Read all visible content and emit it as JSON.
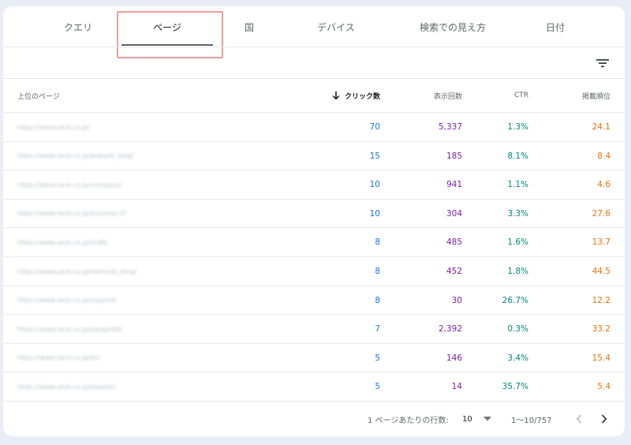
{
  "tabs": [
    {
      "label": "クエリ"
    },
    {
      "label": "ページ"
    },
    {
      "label": "国"
    },
    {
      "label": "デバイス"
    },
    {
      "label": "検索での見え方"
    },
    {
      "label": "日付"
    }
  ],
  "table": {
    "headers": {
      "page": "上位のページ",
      "clicks": "クリック数",
      "impressions": "表示回数",
      "ctr": "CTR",
      "position": "掲載順位"
    },
    "rows": [
      {
        "url": "https://www.seck.co.jp/",
        "clicks": "70",
        "impressions": "5,337",
        "ctr": "1.3%",
        "position": "24.1"
      },
      {
        "url": "https://www.seck.co.jp/website_blog/",
        "clicks": "15",
        "impressions": "185",
        "ctr": "8.1%",
        "position": "8.4"
      },
      {
        "url": "https://www.seck.co.jp/company/",
        "clicks": "10",
        "impressions": "941",
        "ctr": "1.1%",
        "position": "4.6"
      },
      {
        "url": "https://www.seck.co.jp/business-2/",
        "clicks": "10",
        "impressions": "304",
        "ctr": "3.3%",
        "position": "27.6"
      },
      {
        "url": "https://www.seck.co.jp/draft/",
        "clicks": "8",
        "impressions": "485",
        "ctr": "1.6%",
        "position": "13.7"
      },
      {
        "url": "https://www.seck.co.jp/methods_blog/",
        "clicks": "8",
        "impressions": "452",
        "ctr": "1.8%",
        "position": "44.5"
      },
      {
        "url": "https://www.seck.co.jp/support/",
        "clicks": "8",
        "impressions": "30",
        "ctr": "26.7%",
        "position": "12.2"
      },
      {
        "url": "https://www.seck.co.jp/pamphlet/",
        "clicks": "7",
        "impressions": "2,392",
        "ctr": "0.3%",
        "position": "33.2"
      },
      {
        "url": "https://www.seck.co.jp/dx/",
        "clicks": "5",
        "impressions": "146",
        "ctr": "3.4%",
        "position": "15.4"
      },
      {
        "url": "https://www.seck.co.jp/experts/",
        "clicks": "5",
        "impressions": "14",
        "ctr": "35.7%",
        "position": "5.4"
      }
    ]
  },
  "footer": {
    "rows_per_page_label": "1 ページあたりの行数:",
    "rows_per_page_value": "10",
    "range": "1〜10/757"
  },
  "colors": {
    "clicks": "#1a73e8",
    "impressions": "#7b1fa2",
    "ctr": "#00897b",
    "position": "#e8710a",
    "highlight": "#e79f9c"
  },
  "icons": {
    "filter": "filter-icon",
    "sort": "arrow-down-icon",
    "dropdown": "triangle-down-icon",
    "prev": "chevron-left-icon",
    "next": "chevron-right-icon"
  }
}
